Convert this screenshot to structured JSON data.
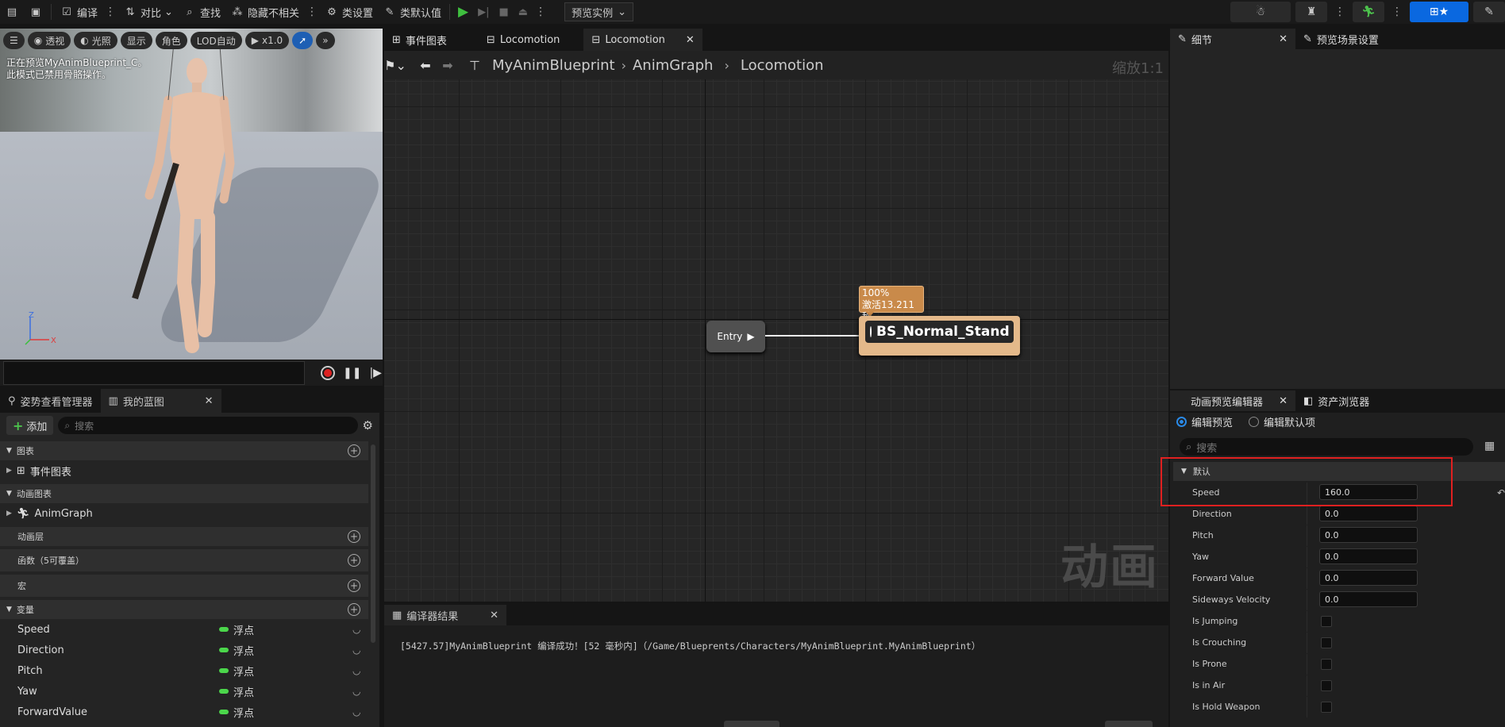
{
  "toolbar": {
    "compile": "编译",
    "diff": "对比",
    "find": "查找",
    "hide_unrelated": "隐藏不相关",
    "class_settings": "类设置",
    "class_defaults": "类默认值",
    "preview_instance": "预览实例"
  },
  "viewport": {
    "buttons": [
      "透视",
      "光照",
      "显示",
      "角色",
      "LOD自动",
      "x1.0"
    ],
    "overlay_line1": "正在预览MyAnimBlueprint_C。",
    "overlay_line2": "此模式已禁用骨骼操作。",
    "axis_z": "Z",
    "axis_x": "X"
  },
  "left_panel": {
    "tab_pose": "姿势查看管理器",
    "tab_blueprint": "我的蓝图",
    "add_label": "添加",
    "search_placeholder": "搜索",
    "sections": {
      "graphs": "图表",
      "event_graph": "事件图表",
      "anim_graphs": "动画图表",
      "anim_graph": "AnimGraph",
      "anim_layers": "动画层",
      "functions": "函数（5可覆盖）",
      "macros": "宏",
      "variables": "变量"
    },
    "variables": [
      {
        "name": "Speed",
        "type": "浮点"
      },
      {
        "name": "Direction",
        "type": "浮点"
      },
      {
        "name": "Pitch",
        "type": "浮点"
      },
      {
        "name": "Yaw",
        "type": "浮点"
      },
      {
        "name": "ForwardValue",
        "type": "浮点"
      }
    ]
  },
  "graph": {
    "tabs": [
      "事件图表",
      "Locomotion",
      "Locomotion"
    ],
    "breadcrumb": [
      "MyAnimBlueprint",
      "AnimGraph",
      "Locomotion"
    ],
    "zoom": "缩放1:1",
    "entry": "Entry",
    "state_name": "BS_Normal_Stand",
    "state_weight": "100%",
    "state_active": "激活13.211秒",
    "watermark": "动画"
  },
  "compiler": {
    "tab": "编译器结果",
    "message": "[5427.57]MyAnimBlueprint 编译成功！[52 毫秒内]（/Game/Blueprents/Characters/MyAnimBlueprint.MyAnimBlueprint）"
  },
  "right_panel": {
    "tab_details": "细节",
    "tab_preview_scene": "预览场景设置",
    "tab_anim_preview": "动画预览编辑器",
    "tab_asset_browser": "资产浏览器",
    "radio_edit_preview": "编辑预览",
    "radio_edit_defaults": "编辑默认项",
    "search_placeholder": "搜索",
    "section_default": "默认",
    "props": [
      {
        "name": "Speed",
        "value": "160.0"
      },
      {
        "name": "Direction",
        "value": "0.0"
      },
      {
        "name": "Pitch",
        "value": "0.0"
      },
      {
        "name": "Yaw",
        "value": "0.0"
      },
      {
        "name": "Forward Value",
        "value": "0.0"
      },
      {
        "name": "Sideways Velocity",
        "value": "0.0"
      }
    ],
    "bool_props": [
      "Is Jumping",
      "Is Crouching",
      "Is Prone",
      "Is in Air",
      "Is Hold Weapon"
    ]
  }
}
